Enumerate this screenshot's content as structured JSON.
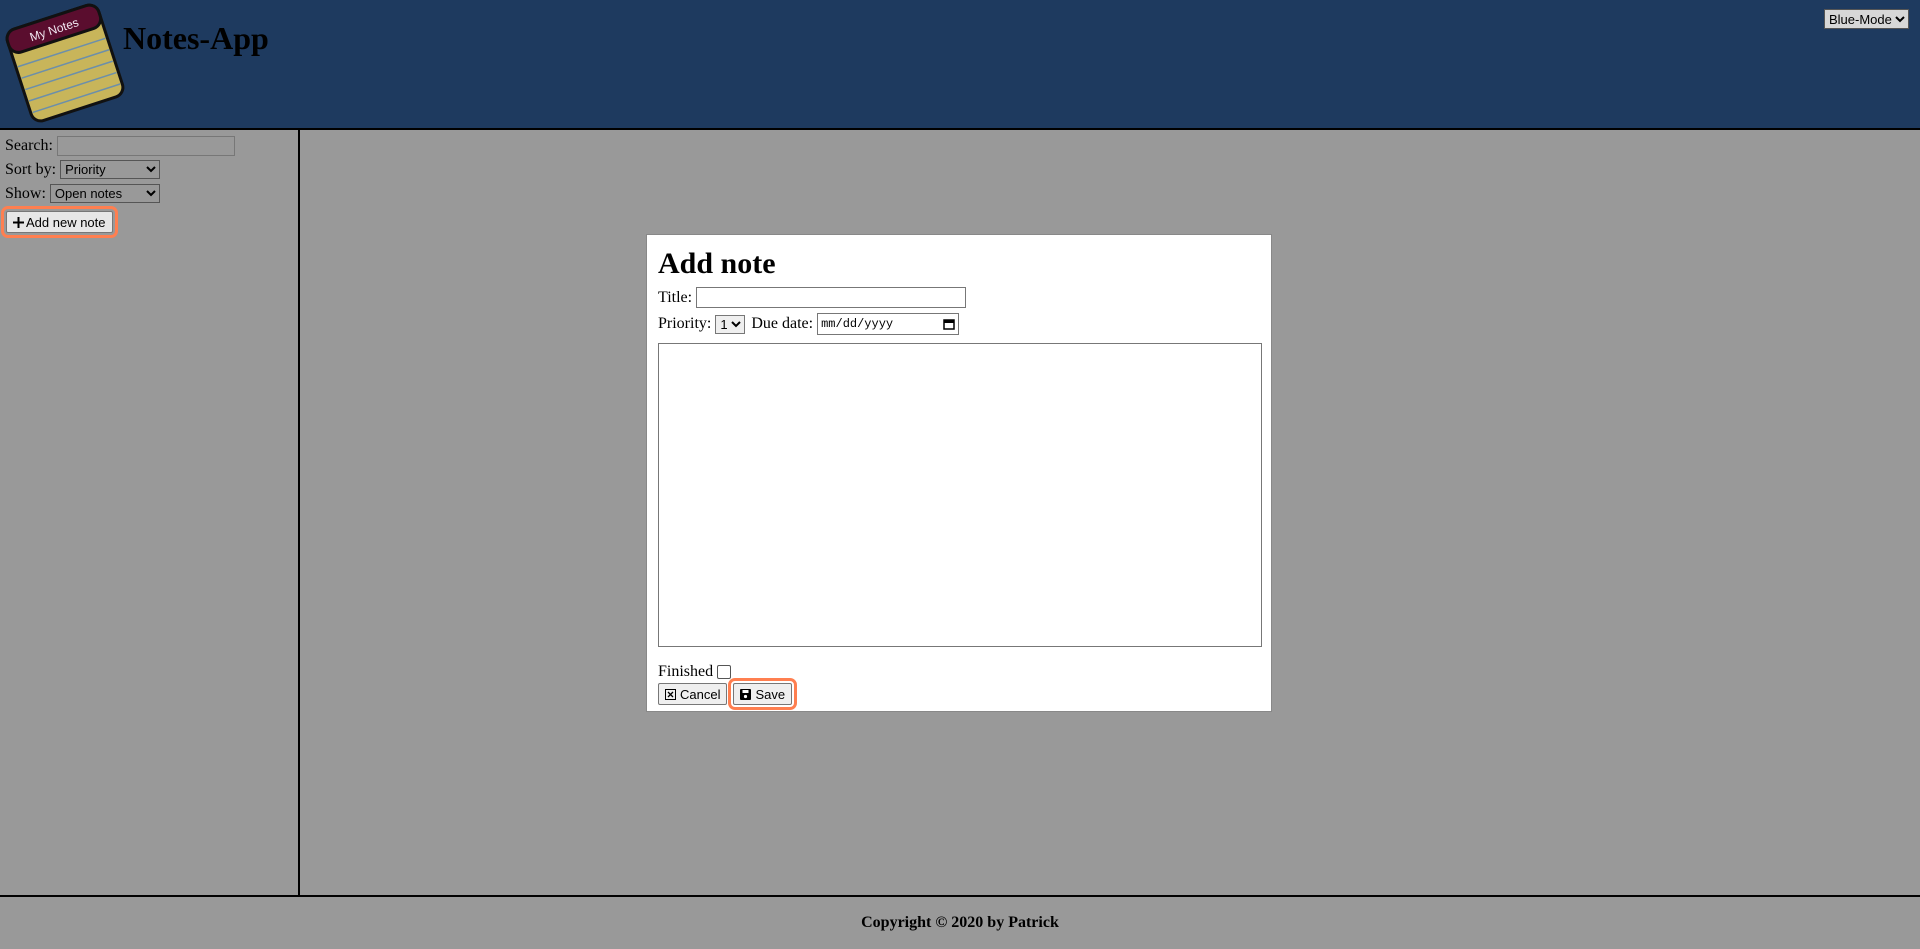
{
  "header": {
    "logo_text": "My Notes",
    "title": "Notes-App",
    "theme": {
      "selected": "Blue-Mode",
      "options": [
        "Blue-Mode"
      ]
    }
  },
  "sidebar": {
    "search_label": "Search:",
    "search_value": "",
    "sort_label": "Sort by:",
    "sort_selected": "Priority",
    "show_label": "Show:",
    "show_selected": "Open notes",
    "add_button_label": "Add new note"
  },
  "dialog": {
    "heading": "Add note",
    "title_label": "Title:",
    "title_value": "",
    "priority_label": "Priority:",
    "priority_selected": "1",
    "due_label": "Due date:",
    "due_placeholder": "mm/dd/yyyy",
    "content_value": "",
    "finished_label": "Finished",
    "cancel_label": "Cancel",
    "save_label": "Save"
  },
  "footer": {
    "copyright": "Copyright © 2020 by Patrick"
  },
  "colors": {
    "header_bg": "#1e3a5f",
    "page_bg": "#999999",
    "highlight": "#ff7f50"
  }
}
